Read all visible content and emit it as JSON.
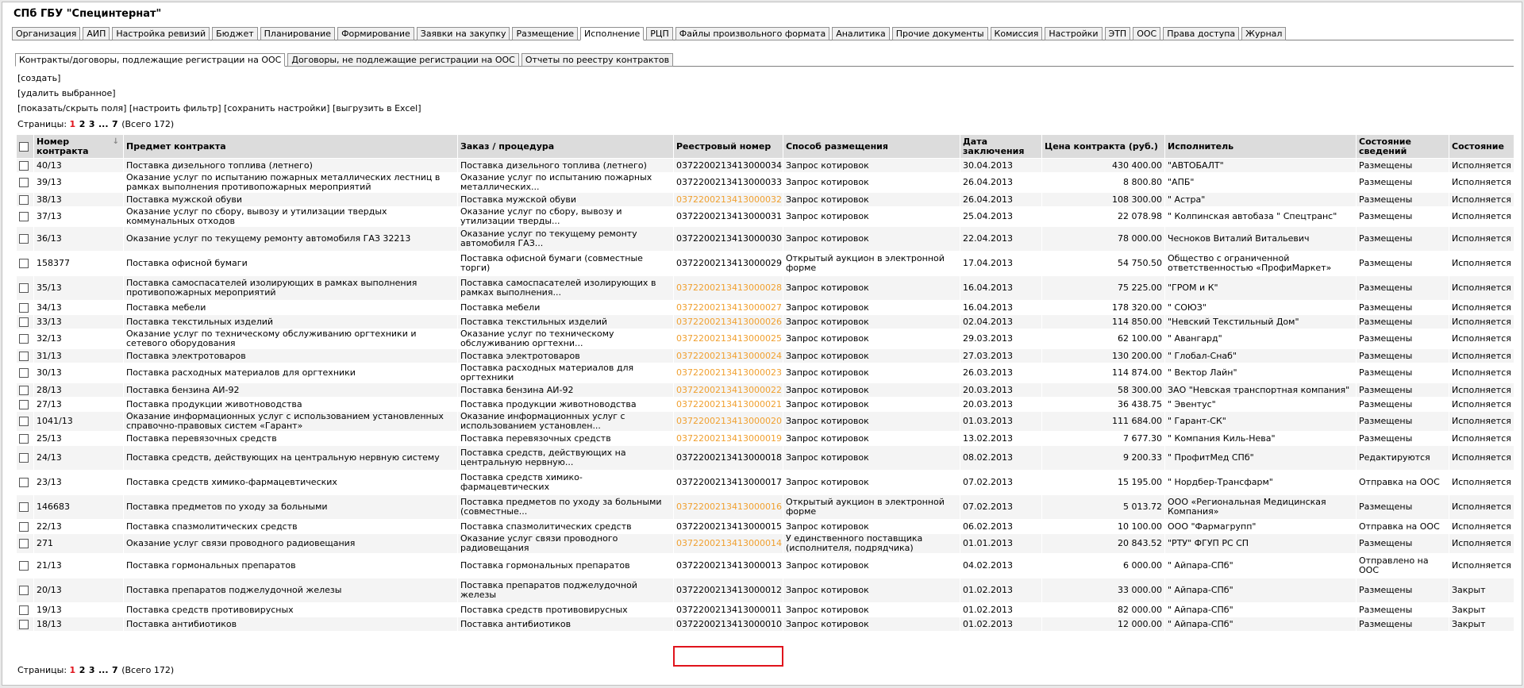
{
  "header": {
    "title": "СПб ГБУ \"Специнтернат\""
  },
  "top_tabs": [
    {
      "label": "Организация"
    },
    {
      "label": "АИП"
    },
    {
      "label": "Настройка ревизий"
    },
    {
      "label": "Бюджет"
    },
    {
      "label": "Планирование"
    },
    {
      "label": "Формирование"
    },
    {
      "label": "Заявки на закупку"
    },
    {
      "label": "Размещение"
    },
    {
      "label": "Исполнение",
      "active": true
    },
    {
      "label": "РЦП"
    },
    {
      "label": "Файлы произвольного формата"
    },
    {
      "label": "Аналитика"
    },
    {
      "label": "Прочие документы"
    },
    {
      "label": "Комиссия"
    },
    {
      "label": "Настройки"
    },
    {
      "label": "ЭТП"
    },
    {
      "label": "ООС"
    },
    {
      "label": "Права доступа"
    },
    {
      "label": "Журнал"
    }
  ],
  "sub_tabs": [
    {
      "label": "Контракты/договоры, подлежащие регистрации на ООС",
      "active": true
    },
    {
      "label": "Договоры, не подлежащие регистрации на ООС"
    },
    {
      "label": "Отчеты по реестру контрактов"
    }
  ],
  "actions": {
    "create": "[создать]",
    "delete_selected": "[удалить выбранное]",
    "toggle_fields": "[показать/скрыть поля]",
    "filter": "[настроить фильтр]",
    "save_settings": "[сохранить настройки]",
    "export_excel": "[выгрузить в Excel]"
  },
  "pager": {
    "label": "Страницы:",
    "pages": [
      "1",
      "2",
      "3",
      "...",
      "7"
    ],
    "current": "1",
    "total": "(Всего 172)"
  },
  "table": {
    "columns": [
      "Номер контракта",
      "Предмет контракта",
      "Заказ / процедура",
      "Реестровый номер",
      "Способ размещения",
      "Дата заключения",
      "Цена контракта (руб.)",
      "Исполнитель",
      "Состояние сведений",
      "Состояние"
    ],
    "rows": [
      {
        "num": "40/13",
        "subject": "Поставка дизельного топлива (летнего)",
        "order": "Поставка дизельного топлива (летнего)",
        "reg": "0372200213413000034",
        "reg_link": false,
        "method": "Запрос котировок",
        "date": "30.04.2013",
        "price": "430 400.00",
        "supplier": "\"АВТОБАЛТ\"",
        "info_state": "Размещены",
        "state": "Исполняется"
      },
      {
        "num": "39/13",
        "subject": "Оказание услуг по испытанию пожарных металлических лестниц в рамках выполнения противопожарных мероприятий",
        "order": "Оказание услуг по испытанию пожарных металлических...",
        "reg": "0372200213413000033",
        "reg_link": false,
        "method": "Запрос котировок",
        "date": "26.04.2013",
        "price": "8 800.80",
        "supplier": "\"АПБ\"",
        "info_state": "Размещены",
        "state": "Исполняется"
      },
      {
        "num": "38/13",
        "subject": "Поставка мужской обуви",
        "order": "Поставка мужской обуви",
        "reg": "0372200213413000032",
        "reg_link": true,
        "method": "Запрос котировок",
        "date": "26.04.2013",
        "price": "108 300.00",
        "supplier": "\" Астра\"",
        "info_state": "Размещены",
        "state": "Исполняется"
      },
      {
        "num": "37/13",
        "subject": "Оказание услуг по сбору, вывозу и утилизации твердых коммунальных отходов",
        "order": "Оказание услуг по сбору, вывозу и утилизации тверды...",
        "reg": "0372200213413000031",
        "reg_link": false,
        "method": "Запрос котировок",
        "date": "25.04.2013",
        "price": "22 078.98",
        "supplier": "\" Колпинская автобаза \" Спецтранс\"",
        "info_state": "Размещены",
        "state": "Исполняется"
      },
      {
        "num": "36/13",
        "subject": "Оказание услуг по текущему ремонту автомобиля ГАЗ 32213",
        "order": "Оказание услуг по текущему ремонту автомобиля ГАЗ...",
        "reg": "0372200213413000030",
        "reg_link": false,
        "method": "Запрос котировок",
        "date": "22.04.2013",
        "price": "78 000.00",
        "supplier": "Чеснoков Виталий Витальевич",
        "info_state": "Размещены",
        "state": "Исполняется"
      },
      {
        "num": "158377",
        "subject": "Поставка офисной бумаги",
        "order": "Поставка офисной бумаги (совместные торги)",
        "reg": "0372200213413000029",
        "reg_link": false,
        "method": "Открытый аукцион в электронной форме",
        "date": "17.04.2013",
        "price": "54 750.50",
        "supplier": "Общество с ограниченной ответственностью «ПрофиМаркет»",
        "info_state": "Размещены",
        "state": "Исполняется"
      },
      {
        "num": "35/13",
        "subject": "Поставка самоспасателей изолирующих в рамках выполнения противопожарных мероприятий",
        "order": "Поставка самоспасателей изолирующих в рамках выполнения...",
        "reg": "0372200213413000028",
        "reg_link": true,
        "method": "Запрос котировок",
        "date": "16.04.2013",
        "price": "75 225.00",
        "supplier": "\"ГРОМ и К\"",
        "info_state": "Размещены",
        "state": "Исполняется"
      },
      {
        "num": "34/13",
        "subject": "Поставка мебели",
        "order": "Поставка мебели",
        "reg": "0372200213413000027",
        "reg_link": true,
        "method": "Запрос котировок",
        "date": "16.04.2013",
        "price": "178 320.00",
        "supplier": "\" СОЮЗ\"",
        "info_state": "Размещены",
        "state": "Исполняется"
      },
      {
        "num": "33/13",
        "subject": "Поставка текстильных изделий",
        "order": "Поставка текстильных изделий",
        "reg": "0372200213413000026",
        "reg_link": true,
        "method": "Запрос котировок",
        "date": "02.04.2013",
        "price": "114 850.00",
        "supplier": "\"Невский Текстильный Дом\"",
        "info_state": "Размещены",
        "state": "Исполняется"
      },
      {
        "num": "32/13",
        "subject": "Оказание услуг по техническому обслуживанию оргтехники и сетевого оборудования",
        "order": "Оказание услуг по техническому обслуживанию оргтехни...",
        "reg": "0372200213413000025",
        "reg_link": true,
        "method": "Запрос котировок",
        "date": "29.03.2013",
        "price": "62 100.00",
        "supplier": "\" Авангард\"",
        "info_state": "Размещены",
        "state": "Исполняется"
      },
      {
        "num": "31/13",
        "subject": "Поставка электротоваров",
        "order": "Поставка электротоваров",
        "reg": "0372200213413000024",
        "reg_link": true,
        "method": "Запрос котировок",
        "date": "27.03.2013",
        "price": "130 200.00",
        "supplier": "\" Глобал-Снаб\"",
        "info_state": "Размещены",
        "state": "Исполняется"
      },
      {
        "num": "30/13",
        "subject": "Поставка расходных материалов для оргтехники",
        "order": "Поставка расходных материалов для оргтехники",
        "reg": "0372200213413000023",
        "reg_link": true,
        "method": "Запрос котировок",
        "date": "26.03.2013",
        "price": "114 874.00",
        "supplier": "\" Вектор Лайн\"",
        "info_state": "Размещены",
        "state": "Исполняется"
      },
      {
        "num": "28/13",
        "subject": "Поставка бензина АИ-92",
        "order": "Поставка бензина АИ-92",
        "reg": "0372200213413000022",
        "reg_link": true,
        "method": "Запрос котировок",
        "date": "20.03.2013",
        "price": "58 300.00",
        "supplier": "ЗАО \"Невская транспортная компания\"",
        "info_state": "Размещены",
        "state": "Исполняется"
      },
      {
        "num": "27/13",
        "subject": "Поставка продукции животноводства",
        "order": "Поставка продукции животноводства",
        "reg": "0372200213413000021",
        "reg_link": true,
        "method": "Запрос котировок",
        "date": "20.03.2013",
        "price": "36 438.75",
        "supplier": "\" Эвентус\"",
        "info_state": "Размещены",
        "state": "Исполняется"
      },
      {
        "num": "1041/13",
        "subject": "Оказание информационных услуг с использованием установленных справочно-правовых систем «Гарант»",
        "order": "Оказание информационных услуг с использованием установлен...",
        "reg": "0372200213413000020",
        "reg_link": true,
        "method": "Запрос котировок",
        "date": "01.03.2013",
        "price": "111 684.00",
        "supplier": "\" Гарант-СК\"",
        "info_state": "Размещены",
        "state": "Исполняется"
      },
      {
        "num": "25/13",
        "subject": "Поставка перевязочных средств",
        "order": "Поставка перевязочных средств",
        "reg": "0372200213413000019",
        "reg_link": true,
        "method": "Запрос котировок",
        "date": "13.02.2013",
        "price": "7 677.30",
        "supplier": "\" Компания Киль-Нева\"",
        "info_state": "Размещены",
        "state": "Исполняется"
      },
      {
        "num": "24/13",
        "subject": "Поставка средств, действующих на центральную нервную систему",
        "order": "Поставка средств, действующих на центральную нервную...",
        "reg": "0372200213413000018",
        "reg_link": false,
        "method": "Запрос котировок",
        "date": "08.02.2013",
        "price": "9 200.33",
        "supplier": "\" ПрофитМед СПб\"",
        "info_state": "Редактируются",
        "state": "Исполняется"
      },
      {
        "num": "23/13",
        "subject": "Поставка средств химико-фармацевтических",
        "order": "Поставка средств химико-фармацевтических",
        "reg": "0372200213413000017",
        "reg_link": false,
        "method": "Запрос котировок",
        "date": "07.02.2013",
        "price": "15 195.00",
        "supplier": "\" Нордбер-Трансфарм\"",
        "info_state": "Отправка на ООС",
        "state": "Исполняется"
      },
      {
        "num": "146683",
        "subject": "Поставка предметов по уходу за больными",
        "order": "Поставка предметов по уходу за больными (совместные...",
        "reg": "0372200213413000016",
        "reg_link": true,
        "method": "Открытый аукцион в электронной форме",
        "date": "07.02.2013",
        "price": "5 013.72",
        "supplier": "ООО «Региональная Медицинская Компания»",
        "info_state": "Размещены",
        "state": "Исполняется"
      },
      {
        "num": "22/13",
        "subject": "Поставка спазмолитических средств",
        "order": "Поставка спазмолитических средств",
        "reg": "0372200213413000015",
        "reg_link": false,
        "method": "Запрос котировок",
        "date": "06.02.2013",
        "price": "10 100.00",
        "supplier": "ООО \"Фармагрупп\"",
        "info_state": "Отправка на ООС",
        "state": "Исполняется"
      },
      {
        "num": "271",
        "subject": "Оказание услуг связи проводного радиовещания",
        "order": "Оказание услуг связи проводного радиовещания",
        "reg": "0372200213413000014",
        "reg_link": true,
        "method": "У единственного поставщика (исполнителя, подрядчика)",
        "date": "01.01.2013",
        "price": "20 843.52",
        "supplier": "\"РТУ\" ФГУП РС СП",
        "info_state": "Размещены",
        "state": "Исполняется"
      },
      {
        "num": "21/13",
        "subject": "Поставка гормональных препаратов",
        "order": "Поставка гормональных препаратов",
        "reg": "0372200213413000013",
        "reg_link": false,
        "method": "Запрос котировок",
        "date": "04.02.2013",
        "price": "6 000.00",
        "supplier": "\" Айпара-СПб\"",
        "info_state": "Отправлено на ООС",
        "state": "Исполняется"
      },
      {
        "num": "20/13",
        "subject": "Поставка препаратов поджелудочной железы",
        "order": "Поставка препаратов поджелудочной железы",
        "reg": "0372200213413000012",
        "reg_link": false,
        "method": "Запрос котировок",
        "date": "01.02.2013",
        "price": "33 000.00",
        "supplier": "\" Айпара-СПб\"",
        "info_state": "Размещены",
        "state": "Закрыт"
      },
      {
        "num": "19/13",
        "subject": "Поставка средств противовирусных",
        "order": "Поставка средств противовирусных",
        "reg": "0372200213413000011",
        "reg_link": false,
        "method": "Запрос котировок",
        "date": "01.02.2013",
        "price": "82 000.00",
        "supplier": "\" Айпара-СПб\"",
        "info_state": "Размещены",
        "state": "Закрыт"
      },
      {
        "num": "18/13",
        "subject": "Поставка антибиотиков",
        "order": "Поставка антибиотиков",
        "reg": "0372200213413000010",
        "reg_link": false,
        "method": "Запрос котировок",
        "date": "01.02.2013",
        "price": "12 000.00",
        "supplier": "\" Айпара-СПб\"",
        "info_state": "Размещены",
        "state": "Закрыт"
      }
    ],
    "row_heights": [
      18,
      25,
      18,
      25,
      31,
      31,
      31,
      18,
      18,
      25,
      18,
      25,
      18,
      18,
      25,
      18,
      31,
      31,
      31,
      18,
      25,
      31,
      31,
      18,
      18
    ]
  },
  "colors": {
    "link_orange": "#f0a030",
    "current_page": "#e0141c",
    "highlight": "#e0141c"
  }
}
